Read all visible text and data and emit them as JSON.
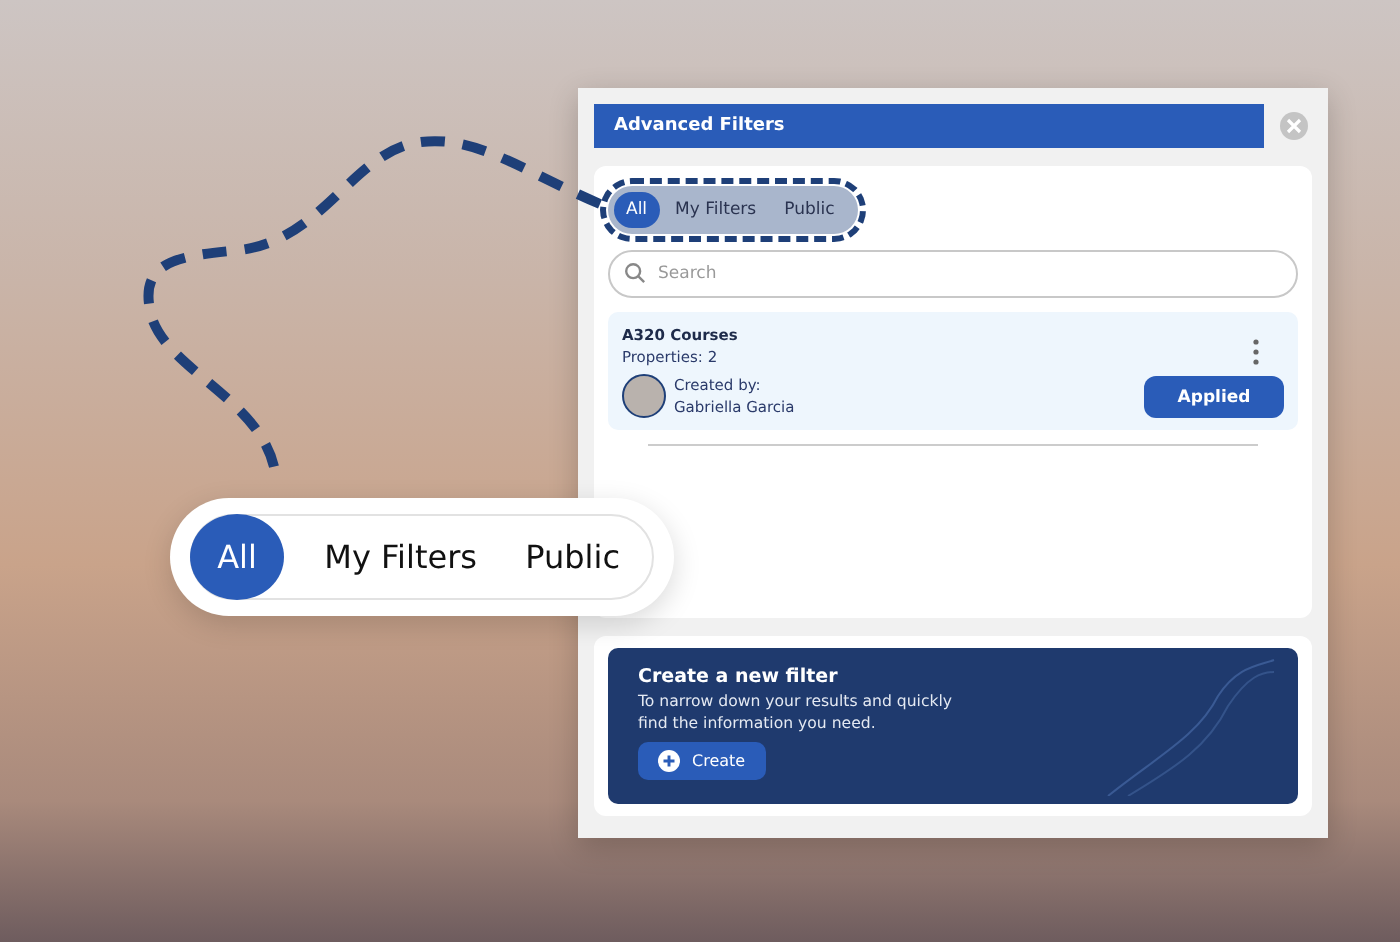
{
  "panel": {
    "title": "Advanced Filters",
    "tabs": [
      {
        "label": "All",
        "selected": true
      },
      {
        "label": "My Filters",
        "selected": false
      },
      {
        "label": "Public",
        "selected": false
      }
    ],
    "search": {
      "placeholder": "Search"
    },
    "filters": [
      {
        "name": "A320 Courses",
        "properties": "Properties: 2",
        "created_by_label": "Created by:",
        "creator": "Gabriella Garcia",
        "status": "Applied"
      }
    ],
    "create_card": {
      "title": "Create a new filter",
      "description": "To narrow down your results and quickly find the information you need.",
      "button": "Create"
    }
  },
  "callout": {
    "tabs": [
      {
        "label": "All",
        "selected": true
      },
      {
        "label": "My Filters",
        "selected": false
      },
      {
        "label": "Public",
        "selected": false
      }
    ]
  }
}
